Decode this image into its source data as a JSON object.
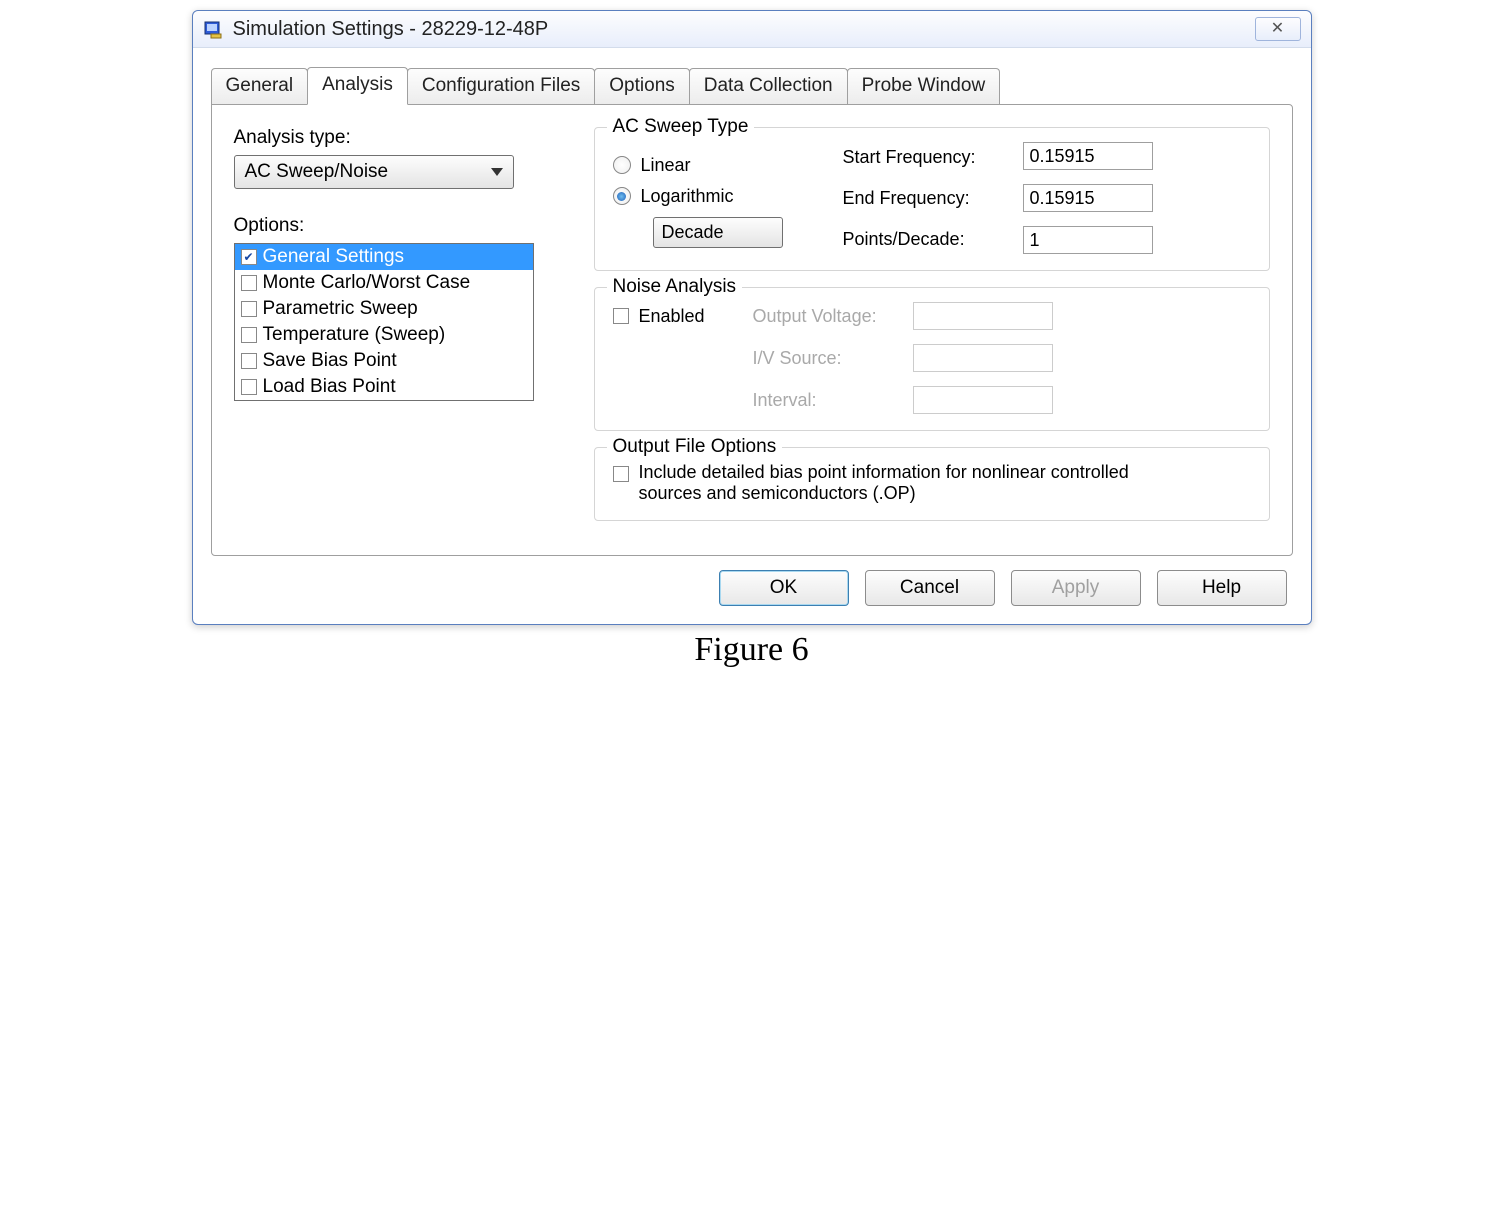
{
  "window": {
    "title": "Simulation Settings - 28229-12-48P",
    "close_glyph": "✕"
  },
  "tabs": [
    "General",
    "Analysis",
    "Configuration Files",
    "Options",
    "Data Collection",
    "Probe Window"
  ],
  "active_tab_index": 1,
  "analysis": {
    "type_label": "Analysis type:",
    "type_value": "AC Sweep/Noise",
    "options_label": "Options:",
    "options": [
      {
        "label": "General Settings",
        "checked": true,
        "selected": true
      },
      {
        "label": "Monte Carlo/Worst Case",
        "checked": false,
        "selected": false
      },
      {
        "label": "Parametric Sweep",
        "checked": false,
        "selected": false
      },
      {
        "label": "Temperature (Sweep)",
        "checked": false,
        "selected": false
      },
      {
        "label": "Save Bias Point",
        "checked": false,
        "selected": false
      },
      {
        "label": "Load Bias Point",
        "checked": false,
        "selected": false
      }
    ]
  },
  "ac_sweep": {
    "legend": "AC Sweep Type",
    "radios": {
      "linear": "Linear",
      "logarithmic": "Logarithmic",
      "selected": "logarithmic"
    },
    "scale_value": "Decade",
    "start_freq_label": "Start Frequency:",
    "start_freq_value": "0.15915",
    "end_freq_label": "End Frequency:",
    "end_freq_value": "0.15915",
    "points_label": "Points/Decade:",
    "points_value": "1"
  },
  "noise": {
    "legend": "Noise Analysis",
    "enabled_label": "Enabled",
    "enabled": false,
    "out_v_label": "Output Voltage:",
    "iv_label": "I/V Source:",
    "interval_label": "Interval:"
  },
  "outfile": {
    "legend": "Output File Options",
    "bias_label": "Include detailed bias point information for nonlinear controlled sources and semiconductors (.OP)",
    "bias_checked": false
  },
  "buttons": {
    "ok": "OK",
    "cancel": "Cancel",
    "apply": "Apply",
    "help": "Help"
  },
  "caption": "Figure 6"
}
